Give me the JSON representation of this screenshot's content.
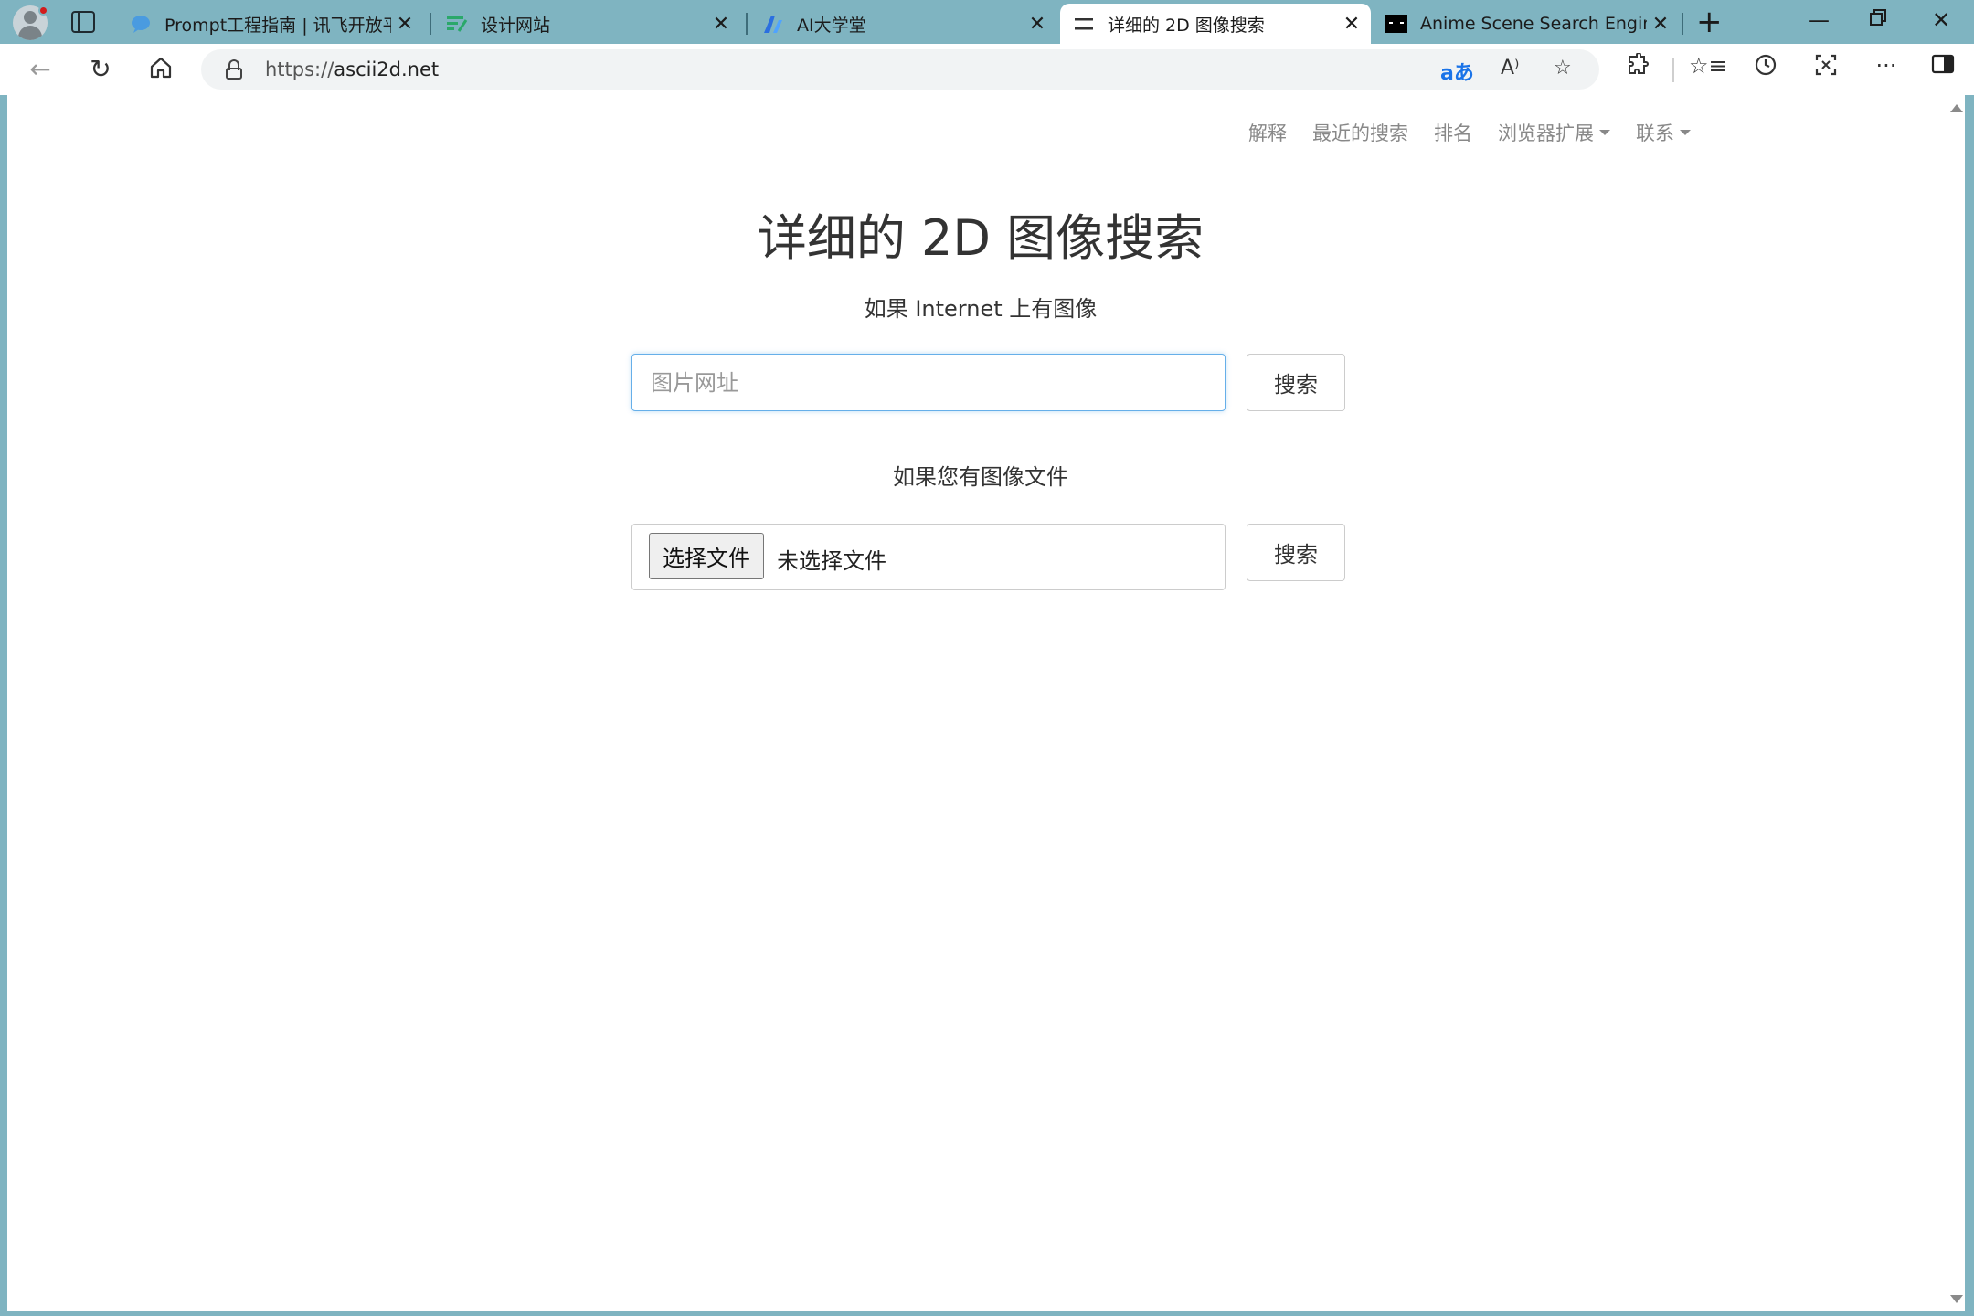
{
  "browser": {
    "tabs": [
      {
        "title": "Prompt工程指南 | 讯飞开放平台",
        "favicon_color": "#4a9be0",
        "active": false
      },
      {
        "title": "设计网站",
        "favicon_color": "#2aa86a",
        "active": false
      },
      {
        "title": "AI大学堂",
        "favicon_color": "#2b6fe0",
        "active": false
      },
      {
        "title": "详细的 2D 图像搜索",
        "favicon_color": "#333333",
        "active": true
      },
      {
        "title": "Anime Scene Search Engine - t",
        "favicon_color": "#000000",
        "active": false
      }
    ],
    "address": {
      "protocol": "https://",
      "host": "ascii2d.net"
    },
    "accent": "#7fb4c1"
  },
  "page": {
    "nav": {
      "explain": "解释",
      "recent": "最近的搜索",
      "ranking": "排名",
      "extensions": "浏览器扩展",
      "contact": "联系"
    },
    "title": "详细的 2D 图像搜索",
    "url_section": {
      "label": "如果 Internet 上有图像",
      "placeholder": "图片网址",
      "button": "搜索"
    },
    "file_section": {
      "label": "如果您有图像文件",
      "choose_button": "选择文件",
      "status": "未选择文件",
      "button": "搜索"
    },
    "colors": {
      "input_focus": "#66afe9",
      "text": "#333333",
      "nav_text": "#888888"
    }
  }
}
